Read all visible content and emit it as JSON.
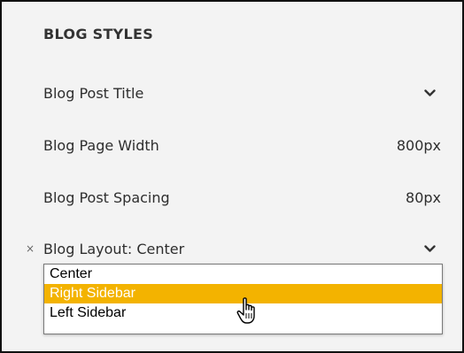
{
  "panel": {
    "section_title": "BLOG STYLES",
    "rows": [
      {
        "label": "Blog Post Title",
        "value": "",
        "control": "chevron-down-icon"
      },
      {
        "label": "Blog Page Width",
        "value": "800px"
      },
      {
        "label": "Blog Post Spacing",
        "value": "80px"
      },
      {
        "label": "Blog Layout: Center",
        "value": "",
        "control": "chevron-down-icon",
        "clear_glyph": "×"
      }
    ]
  },
  "layout_dropdown": {
    "options": [
      "Center",
      "Right Sidebar",
      "Left Sidebar"
    ],
    "highlighted": "Right Sidebar",
    "highlight_color": "#f3b300"
  },
  "colors": {
    "panel_background": "#f3f3f3",
    "text": "#2e2e2e"
  },
  "cursor": "hand-pointer-icon"
}
